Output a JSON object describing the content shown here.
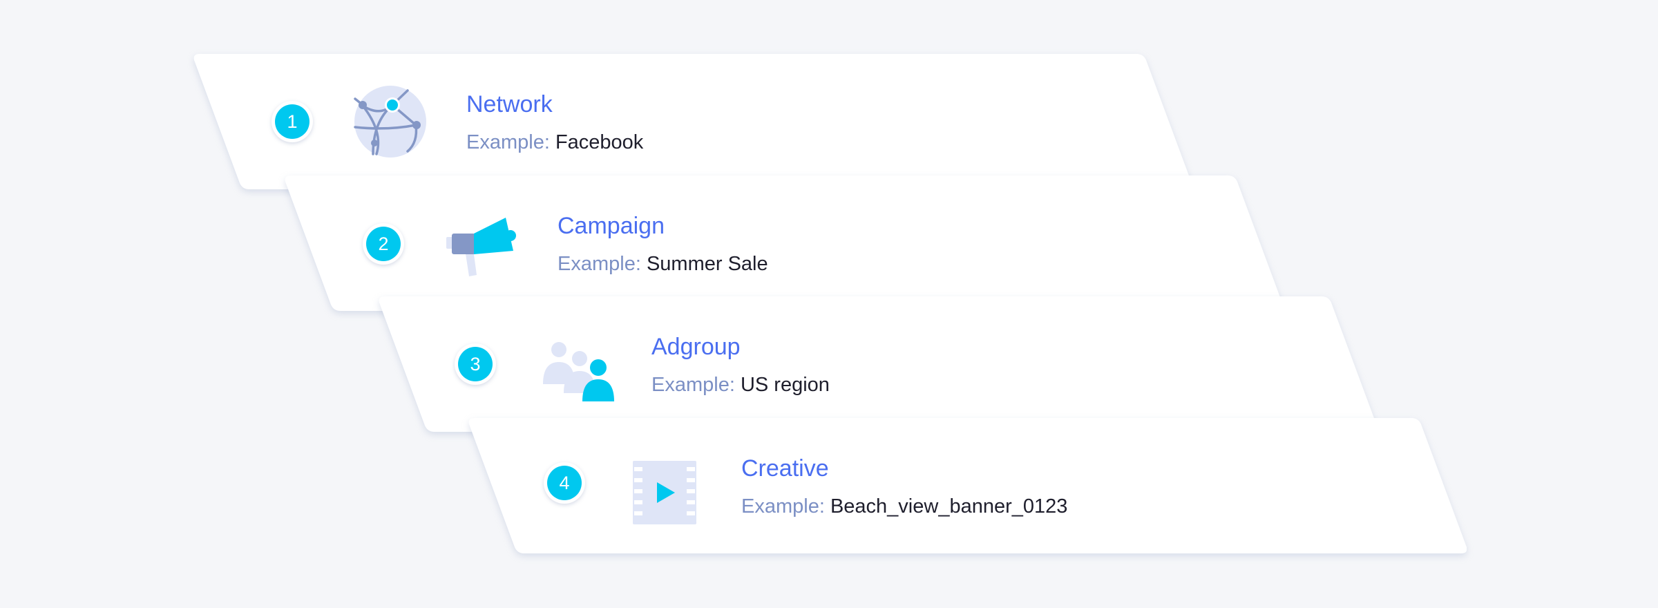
{
  "colors": {
    "background": "#f5f6f9",
    "card": "#ffffff",
    "badge": "#00c8ef",
    "title": "#4a6ef0",
    "example_label": "#7b8fc4",
    "example_value": "#1e1e2c"
  },
  "levels": [
    {
      "number": "1",
      "icon": "globe-network-icon",
      "title": "Network",
      "example_label": "Example:",
      "example_value": "Facebook"
    },
    {
      "number": "2",
      "icon": "megaphone-icon",
      "title": "Campaign",
      "example_label": "Example:",
      "example_value": "Summer Sale"
    },
    {
      "number": "3",
      "icon": "user-group-icon",
      "title": "Adgroup",
      "example_label": "Example:",
      "example_value": "US region"
    },
    {
      "number": "4",
      "icon": "video-film-icon",
      "title": "Creative",
      "example_label": "Example:",
      "example_value": "Beach_view_banner_0123"
    }
  ]
}
